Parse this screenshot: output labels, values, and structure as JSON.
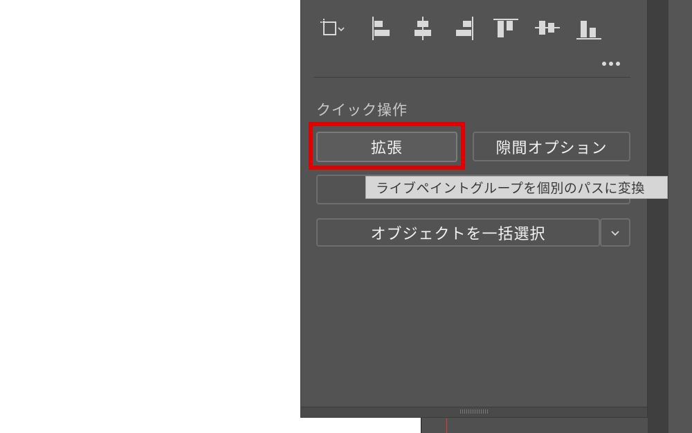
{
  "toolbar": {
    "icons": [
      "transform-bounds-icon",
      "align-left-icon",
      "align-horizontal-center-icon",
      "align-right-icon",
      "align-top-icon",
      "align-vertical-center-icon",
      "align-bottom-icon"
    ],
    "more_label": "•••"
  },
  "quick_actions": {
    "title": "クイック操作",
    "expand_label": "拡張",
    "gap_options_label": "隙間オプション",
    "select_all_label": "オブジェクトを一括選択"
  },
  "tooltip": {
    "text": "ライブペイントグループを個別のパスに変換"
  },
  "colors": {
    "panel_bg": "#535353",
    "highlight": "#e00000",
    "tooltip_bg": "#d6d6d6"
  }
}
